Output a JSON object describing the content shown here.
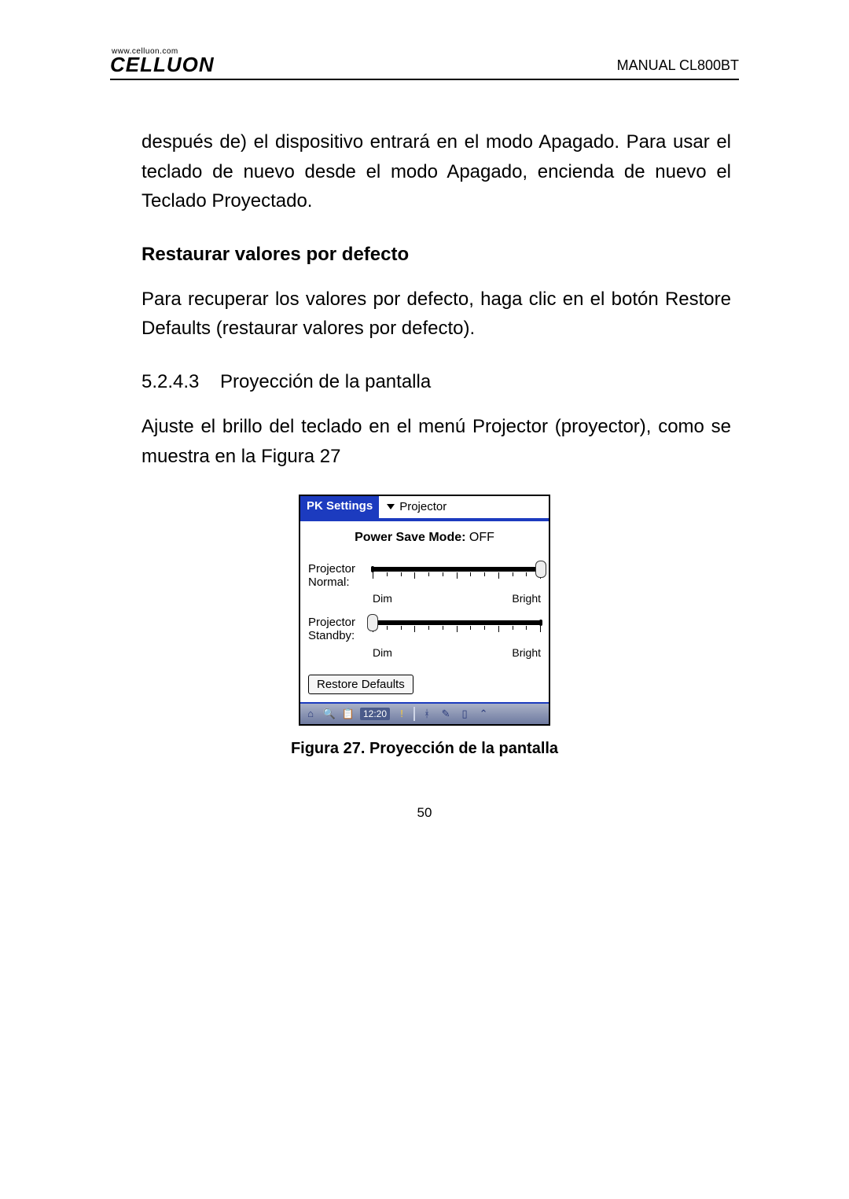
{
  "header": {
    "logo_url": "www.celluon.com",
    "logo_word": "CELLUON",
    "manual_id": "MANUAL CL800BT"
  },
  "content": {
    "intro_para": "después de) el dispositivo entrará en el modo Apagado. Para usar el teclado de nuevo desde el modo Apagado, encienda de nuevo el Teclado Proyectado.",
    "section_title": "Restaurar valores por defecto",
    "section_para": "Para recuperar los valores por defecto, haga clic en el botón Restore Defaults (restaurar valores por defecto).",
    "sub_number": "5.2.4.3",
    "sub_title": "Proyección de la pantalla",
    "sub_para": "Ajuste el brillo del teclado en el menú Projector (proyector), como se muestra en la Figura 27"
  },
  "device": {
    "app_name": "PK Settings",
    "menu_label": "Projector",
    "psm_label": "Power Save Mode:",
    "psm_value": "OFF",
    "slider1_label": "Projector Normal:",
    "slider2_label": "Projector Standby:",
    "dim_label": "Dim",
    "bright_label": "Bright",
    "restore_btn": "Restore Defaults",
    "taskbar": {
      "clock": "12:20",
      "icons": {
        "home": "⌂",
        "search": "🔍",
        "clipboard": "📋",
        "alert": "!",
        "bluetooth": "ᚼ",
        "pen": "✎",
        "battery": "▯",
        "arrow": "⌃"
      }
    }
  },
  "figure_caption": "Figura 27. Proyección de la pantalla",
  "page_number": "50",
  "chart_data": {
    "type": "table",
    "title": "PK Settings — Projector",
    "rows": [
      {
        "setting": "Power Save Mode",
        "value": "OFF"
      },
      {
        "setting": "Projector Normal",
        "scale": "Dim–Bright",
        "position_percent": 100
      },
      {
        "setting": "Projector Standby",
        "scale": "Dim–Bright",
        "position_percent": 0
      }
    ]
  }
}
